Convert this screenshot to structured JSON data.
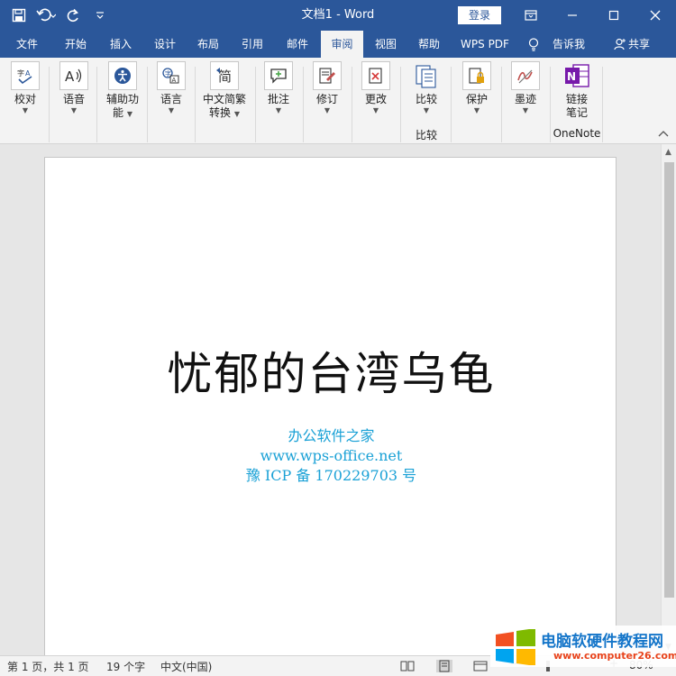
{
  "window": {
    "title": "文档1  -  Word",
    "login_label": "登录"
  },
  "tabs": [
    {
      "label": "文件"
    },
    {
      "label": "开始"
    },
    {
      "label": "插入"
    },
    {
      "label": "设计"
    },
    {
      "label": "布局"
    },
    {
      "label": "引用"
    },
    {
      "label": "邮件"
    },
    {
      "label": "审阅",
      "active": true
    },
    {
      "label": "视图"
    },
    {
      "label": "帮助"
    },
    {
      "label": "WPS PDF"
    },
    {
      "label": "告诉我"
    },
    {
      "label": "共享"
    }
  ],
  "ribbon": {
    "buttons": [
      {
        "label": "校对",
        "icon": "proofing-icon"
      },
      {
        "label": "语音",
        "icon": "read-aloud-icon"
      },
      {
        "label": "辅助功",
        "label2": "能",
        "icon": "accessibility-icon"
      },
      {
        "label": "语言",
        "icon": "language-icon"
      },
      {
        "label": "中文简繁",
        "label2": "转换",
        "icon": "chinese-conversion-icon"
      },
      {
        "label": "批注",
        "icon": "comment-icon"
      },
      {
        "label": "修订",
        "icon": "track-changes-icon"
      },
      {
        "label": "更改",
        "icon": "changes-icon"
      },
      {
        "label": "比较",
        "icon": "compare-icon"
      },
      {
        "label": "保护",
        "icon": "protect-icon"
      },
      {
        "label": "墨迹",
        "icon": "ink-icon"
      },
      {
        "label": "链接",
        "label2": "笔记",
        "icon": "onenote-icon"
      }
    ],
    "group_labels": {
      "compare": "比较",
      "onenote": "OneNote"
    }
  },
  "document": {
    "heading": "忧郁的台湾乌龟",
    "lines": [
      "办公软件之家",
      "www.wps-office.net",
      "豫 ICP 备 170229703 号"
    ]
  },
  "status": {
    "page": "第 1 页，共 1 页",
    "words": "19 个字",
    "language": "中文(中国)",
    "zoom": "80%"
  },
  "watermark": {
    "text": "电脑软硬件教程网",
    "url": "www.computer26.com"
  },
  "colors": {
    "accent": "#2b579a",
    "doc_link": "#1aa1d6"
  }
}
